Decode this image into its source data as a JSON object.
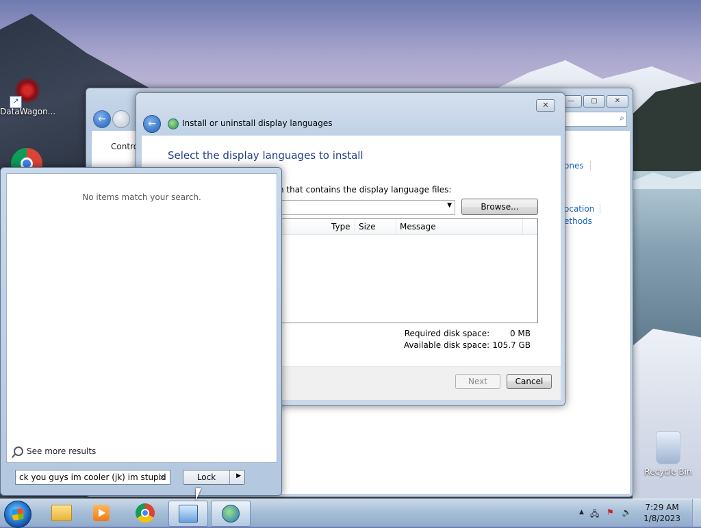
{
  "desktop": {
    "icons": [
      {
        "label": "DataWagon...",
        "icon": "datawagon-icon"
      },
      {
        "label": "Recycle Bin",
        "icon": "recycle-bin-icon"
      }
    ],
    "shortcut_arrow": "↗"
  },
  "control_panel": {
    "breadcrumb_fragment": "Contro",
    "back_glyph": "←",
    "window_buttons": {
      "minimize": "—",
      "maximize": "▢",
      "close": "✕"
    },
    "search_icon": "⌕",
    "links": {
      "timezones": "ones",
      "location": "ocation",
      "methods": "ethods"
    }
  },
  "install_dialog": {
    "title": "Install or uninstall display languages",
    "close_glyph": "✕",
    "back_glyph": "←",
    "heading": "Select the display languages to install",
    "browse_label": "n that contains the display language files:",
    "browse_button": "Browse...",
    "dropdown_arrow": "▼",
    "columns": [
      "Type",
      "Size",
      "Message"
    ],
    "required_label": "Required disk space:",
    "required_value": "0 MB",
    "available_label": "Available disk space:",
    "available_value": "105.7 GB",
    "next_button": "Next",
    "cancel_button": "Cancel"
  },
  "start_menu": {
    "no_items": "No items match your search.",
    "see_more": "See more results",
    "search_value": "ck you guys im cooler (jk) im stupid",
    "clear_glyph": "×",
    "lock_label": "Lock",
    "lock_arrow": "▶"
  },
  "taskbar": {
    "apps": [
      {
        "name": "windows-explorer",
        "icon": "folder-icon",
        "active": false
      },
      {
        "name": "media-player",
        "icon": "media-player-icon",
        "active": false
      },
      {
        "name": "google-chrome",
        "icon": "chrome-icon",
        "active": false
      },
      {
        "name": "control-panel",
        "icon": "control-panel-icon",
        "active": true
      },
      {
        "name": "install-languages",
        "icon": "globe-icon",
        "active": true
      }
    ],
    "tray": {
      "show_hidden": "▲",
      "network": "🖧",
      "action_center": "⚑",
      "volume": "🔊"
    },
    "time": "7:29 AM",
    "date": "1/8/2023"
  }
}
